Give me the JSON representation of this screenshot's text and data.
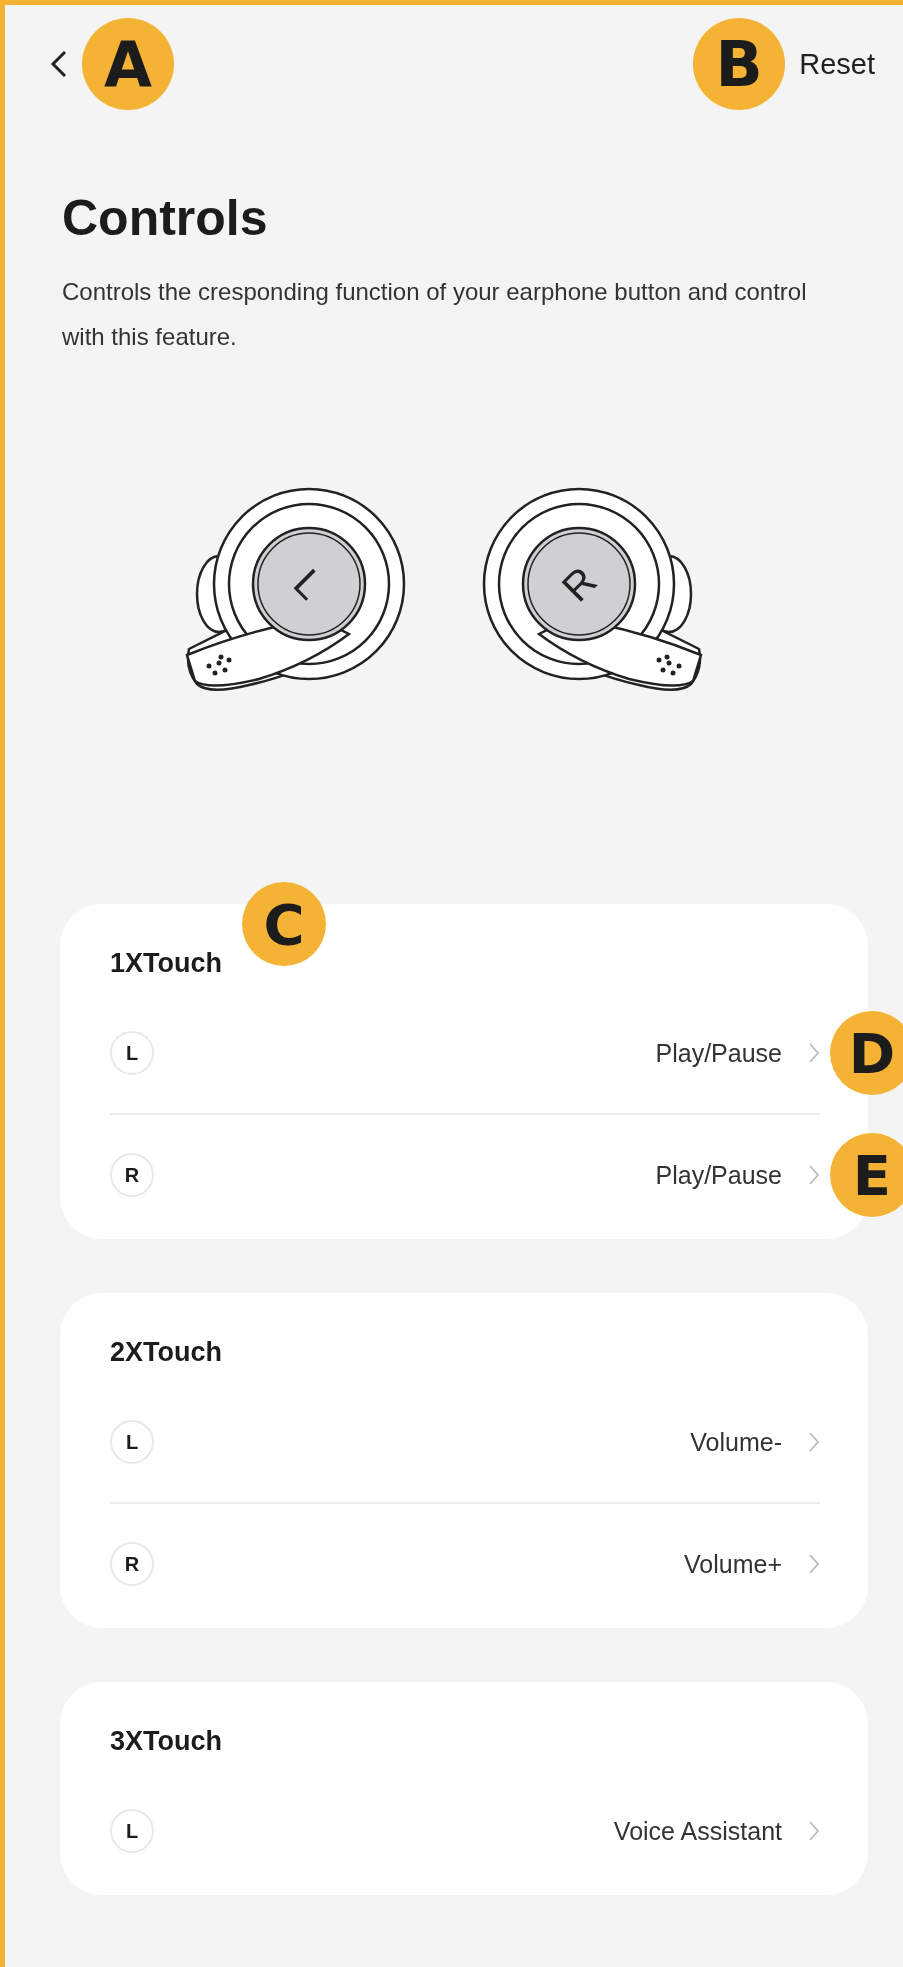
{
  "header": {
    "back_marker": "A",
    "reset": {
      "label": "Reset",
      "marker": "B"
    }
  },
  "title": "Controls",
  "description": "Controls the cresponding function of your earphone button and control with this feature.",
  "earbuds": [
    {
      "kind": "left",
      "label": "L"
    },
    {
      "kind": "right",
      "label": "R"
    }
  ],
  "cards": [
    {
      "title": "1XTouch",
      "marker": "C",
      "rows": [
        {
          "side": "L",
          "value": "Play/Pause",
          "marker": "D"
        },
        {
          "side": "R",
          "value": "Play/Pause",
          "marker": "E"
        }
      ]
    },
    {
      "title": "2XTouch",
      "rows": [
        {
          "side": "L",
          "value": "Volume-"
        },
        {
          "side": "R",
          "value": "Volume+"
        }
      ]
    },
    {
      "title": "3XTouch",
      "rows": [
        {
          "side": "L",
          "value": "Voice Assistant"
        }
      ]
    }
  ]
}
